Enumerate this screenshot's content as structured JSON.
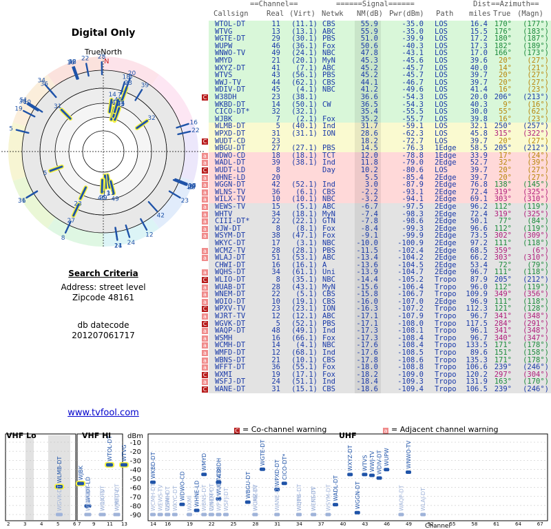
{
  "title": "Digital Only",
  "compass_label": "TrueNorth",
  "north_mark": "N",
  "search": {
    "heading": "Search Criteria",
    "address": "Address: street level",
    "zipcode": "Zipcode 48161",
    "db_label": "db datecode",
    "db_value": "201207061717"
  },
  "link": "www.tvfool.com",
  "headers": {
    "group_channel": "==Channel==",
    "group_signal": "======Signal======",
    "group_dist": "Dist",
    "group_azimuth": "==Azimuth==",
    "callsign": "Callsign",
    "real": "Real",
    "virt": "(Virt)",
    "network": "Netwk",
    "nm": "NM(dB)",
    "pwr": "Pwr(dBm)",
    "path": "Path",
    "miles": "miles",
    "true": "True",
    "magn": "(Magn)"
  },
  "colors": {
    "green": "#d9f7d9",
    "yellow": "#fafad0",
    "red": "#ffd9d9",
    "gray": "#e3e3e3",
    "header_line": "#888888",
    "link": "#0000cc",
    "warn_co": "#b81c1c",
    "warn_adj": "#f08a8a",
    "station_blue": "#1f53a8"
  },
  "stations": [
    {
      "call": "WTOL-DT",
      "real": "11",
      "virt": "(11.1)",
      "net": "CBS",
      "nm": "55.9",
      "pwr": "-35.0",
      "path": "LOS",
      "dist": "16.4",
      "az": "170°",
      "mag": "(177°)",
      "band": "green",
      "warn": ""
    },
    {
      "call": "WTVG",
      "real": "13",
      "virt": "(13.1)",
      "net": "ABC",
      "nm": "55.9",
      "pwr": "-35.0",
      "path": "LOS",
      "dist": "15.5",
      "az": "176°",
      "mag": "(183°)",
      "band": "green",
      "warn": ""
    },
    {
      "call": "WGTE-DT",
      "real": "29",
      "virt": "(30.1)",
      "net": "PBS",
      "nm": "51.0",
      "pwr": "-39.9",
      "path": "LOS",
      "dist": "17.2",
      "az": "180°",
      "mag": "(187°)",
      "band": "green",
      "warn": ""
    },
    {
      "call": "WUPW",
      "real": "46",
      "virt": "(36.1)",
      "net": "Fox",
      "nm": "50.6",
      "pwr": "-40.3",
      "path": "LOS",
      "dist": "17.3",
      "az": "182°",
      "mag": "(189°)",
      "band": "green",
      "warn": ""
    },
    {
      "call": "WNWO-TV",
      "real": "49",
      "virt": "(24.1)",
      "net": "NBC",
      "nm": "47.8",
      "pwr": "-43.1",
      "path": "LOS",
      "dist": "17.0",
      "az": "166°",
      "mag": "(173°)",
      "band": "green",
      "warn": ""
    },
    {
      "call": "WMYD",
      "real": "21",
      "virt": "(20.1)",
      "net": "MyN",
      "nm": "45.3",
      "pwr": "-45.6",
      "path": "LOS",
      "dist": "39.6",
      "az": "20°",
      "mag": "(27°)",
      "band": "green",
      "warn": ""
    },
    {
      "call": "WXYZ-DT",
      "real": "41",
      "virt": "(7.1)",
      "net": "ABC",
      "nm": "45.2",
      "pwr": "-45.7",
      "path": "LOS",
      "dist": "40.0",
      "az": "14°",
      "mag": "(21°)",
      "band": "green",
      "warn": ""
    },
    {
      "call": "WTVS",
      "real": "43",
      "virt": "(56.1)",
      "net": "PBS",
      "nm": "45.2",
      "pwr": "-45.7",
      "path": "LOS",
      "dist": "39.7",
      "az": "20°",
      "mag": "(27°)",
      "band": "green",
      "warn": ""
    },
    {
      "call": "WWJ-TV",
      "real": "44",
      "virt": "(62.1)",
      "net": "CBS",
      "nm": "44.1",
      "pwr": "-46.7",
      "path": "LOS",
      "dist": "39.7",
      "az": "20°",
      "mag": "(27°)",
      "band": "green",
      "warn": ""
    },
    {
      "call": "WDIV-DT",
      "real": "45",
      "virt": "(4.1)",
      "net": "NBC",
      "nm": "41.2",
      "pwr": "-49.6",
      "path": "LOS",
      "dist": "41.4",
      "az": "16°",
      "mag": "(23°)",
      "band": "green",
      "warn": ""
    },
    {
      "call": "W38DH",
      "real": "23",
      "virt": "(38.1)",
      "net": "",
      "nm": "36.6",
      "pwr": "-54.3",
      "path": "LOS",
      "dist": "20.0",
      "az": "206°",
      "mag": "(213°)",
      "band": "green",
      "warn": "C"
    },
    {
      "call": "WKBD-DT",
      "real": "14",
      "virt": "(50.1)",
      "net": "CW",
      "nm": "36.5",
      "pwr": "-54.3",
      "path": "LOS",
      "dist": "40.3",
      "az": "9°",
      "mag": "(16°)",
      "band": "green",
      "warn": ""
    },
    {
      "call": "CICO-DT*",
      "real": "32",
      "virt": "(32.1)",
      "net": "",
      "nm": "35.4",
      "pwr": "-55.5",
      "path": "LOS",
      "dist": "30.0",
      "az": "55°",
      "mag": "(62°)",
      "band": "green",
      "warn": ""
    },
    {
      "call": "WJBK",
      "real": "7",
      "virt": "(2.1)",
      "net": "Fox",
      "nm": "35.2",
      "pwr": "-55.7",
      "path": "LOS",
      "dist": "39.8",
      "az": "16°",
      "mag": "(23°)",
      "band": "green",
      "warn": ""
    },
    {
      "call": "WLMB-DT",
      "real": "5",
      "virt": "(40.1)",
      "net": "Ind",
      "nm": "31.7",
      "pwr": "-59.1",
      "path": "LOS",
      "dist": "32.1",
      "az": "250°",
      "mag": "(257°)",
      "band": "yellow",
      "warn": ""
    },
    {
      "call": "WPXD-DT",
      "real": "31",
      "virt": "(31.1)",
      "net": "ION",
      "nm": "28.6",
      "pwr": "-62.3",
      "path": "LOS",
      "dist": "45.8",
      "az": "315°",
      "mag": "(322°)",
      "band": "yellow",
      "warn": ""
    },
    {
      "call": "WUDT-CD",
      "real": "23",
      "virt": "",
      "net": "",
      "nm": "18.2",
      "pwr": "-72.7",
      "path": "LOS",
      "dist": "39.7",
      "az": "20°",
      "mag": "(27°)",
      "band": "yellow",
      "warn": "C"
    },
    {
      "call": "WBGU-DT",
      "real": "27",
      "virt": "(27.1)",
      "net": "PBS",
      "nm": "14.5",
      "pwr": "-76.3",
      "path": "1Edge",
      "dist": "58.5",
      "az": "205°",
      "mag": "(212°)",
      "band": "yellow",
      "warn": ""
    },
    {
      "call": "WDWO-CD",
      "real": "18",
      "virt": "(18.1)",
      "net": "TCT",
      "nm": "12.0",
      "pwr": "-78.8",
      "path": "1Edge",
      "dist": "33.9",
      "az": "17°",
      "mag": "(24°)",
      "band": "red",
      "warn": "A"
    },
    {
      "call": "WADL-DT",
      "real": "39",
      "virt": "(38.1)",
      "net": "Ind",
      "nm": "11.8",
      "pwr": "-79.0",
      "path": "2Edge",
      "dist": "52.7",
      "az": "32°",
      "mag": "(39°)",
      "band": "red",
      "warn": "A"
    },
    {
      "call": "WUDT-LD",
      "real": "8",
      "virt": "",
      "net": "Day",
      "nm": "10.2",
      "pwr": "-80.6",
      "path": "LOS",
      "dist": "39.7",
      "az": "20°",
      "mag": "(27°)",
      "band": "red",
      "warn": "AC"
    },
    {
      "call": "WHNE-LD",
      "real": "20",
      "virt": "",
      "net": "",
      "nm": "5.5",
      "pwr": "-85.4",
      "path": "2Edge",
      "dist": "39.7",
      "az": "20°",
      "mag": "(27°)",
      "band": "red",
      "warn": "A"
    },
    {
      "call": "WGGN-DT",
      "real": "42",
      "virt": "(52.1)",
      "net": "Ind",
      "nm": "3.0",
      "pwr": "-87.9",
      "path": "2Edge",
      "dist": "76.8",
      "az": "138°",
      "mag": "(145°)",
      "band": "red",
      "warn": "A"
    },
    {
      "call": "WLNS-TV",
      "real": "36",
      "virt": "(6.1)",
      "net": "CBS",
      "nm": "-2.2",
      "pwr": "-93.1",
      "path": "2Edge",
      "dist": "72.4",
      "az": "319°",
      "mag": "(325°)",
      "band": "red",
      "warn": "A"
    },
    {
      "call": "WILX-TV",
      "real": "10",
      "virt": "(10.1)",
      "net": "NBC",
      "nm": "-3.2",
      "pwr": "-94.1",
      "path": "2Edge",
      "dist": "69.1",
      "az": "303°",
      "mag": "(310°)",
      "band": "red",
      "warn": "A"
    },
    {
      "call": "WEWS-TV",
      "real": "15",
      "virt": "(5.1)",
      "net": "ABC",
      "nm": "-6.7",
      "pwr": "-97.5",
      "path": "2Edge",
      "dist": "96.2",
      "az": "112°",
      "mag": "(119°)",
      "band": "gray",
      "warn": "A"
    },
    {
      "call": "WHTV",
      "real": "34",
      "virt": "(18.1)",
      "net": "MyN",
      "nm": "-7.4",
      "pwr": "-98.3",
      "path": "2Edge",
      "dist": "72.4",
      "az": "319°",
      "mag": "(325°)",
      "band": "gray",
      "warn": "A"
    },
    {
      "call": "CIII-DT*",
      "real": "22",
      "virt": "(22.1)",
      "net": "GTN",
      "nm": "-7.8",
      "pwr": "-98.6",
      "path": "2Edge",
      "dist": "50.1",
      "az": "77°",
      "mag": "(84°)",
      "band": "gray",
      "warn": "A"
    },
    {
      "call": "WJW-DT",
      "real": "8",
      "virt": "(8.1)",
      "net": "Fox",
      "nm": "-8.4",
      "pwr": "-99.3",
      "path": "2Edge",
      "dist": "96.6",
      "az": "112°",
      "mag": "(119°)",
      "band": "gray",
      "warn": "A"
    },
    {
      "call": "WSYM-DT",
      "real": "38",
      "virt": "(47.1)",
      "net": "Fox",
      "nm": "-9.1",
      "pwr": "-99.9",
      "path": "2Edge",
      "dist": "73.5",
      "az": "302°",
      "mag": "(309°)",
      "band": "gray",
      "warn": "A"
    },
    {
      "call": "WKYC-DT",
      "real": "17",
      "virt": "(3.1)",
      "net": "NBC",
      "nm": "-10.0",
      "pwr": "-100.9",
      "path": "2Edge",
      "dist": "97.2",
      "az": "111°",
      "mag": "(118°)",
      "band": "gray",
      "warn": ""
    },
    {
      "call": "WCMZ-TV",
      "real": "28",
      "virt": "(28.1)",
      "net": "PBS",
      "nm": "-11.5",
      "pwr": "-102.4",
      "path": "2Edge",
      "dist": "68.5",
      "az": "359°",
      "mag": "(6°)",
      "band": "gray",
      "warn": "A"
    },
    {
      "call": "WLAJ-DT",
      "real": "51",
      "virt": "(53.1)",
      "net": "ABC",
      "nm": "-13.4",
      "pwr": "-104.2",
      "path": "2Edge",
      "dist": "66.2",
      "az": "303°",
      "mag": "(310°)",
      "band": "gray",
      "warn": "A"
    },
    {
      "call": "CHWI-DT",
      "real": "16",
      "virt": "(16.1)",
      "net": "A",
      "nm": "-13.6",
      "pwr": "-104.5",
      "path": "2Edge",
      "dist": "53.4",
      "az": "72°",
      "mag": "(79°)",
      "band": "gray",
      "warn": ""
    },
    {
      "call": "WQHS-DT",
      "real": "34",
      "virt": "(61.1)",
      "net": "Uni",
      "nm": "-13.9",
      "pwr": "-104.7",
      "path": "2Edge",
      "dist": "96.7",
      "az": "111°",
      "mag": "(118°)",
      "band": "gray",
      "warn": "A"
    },
    {
      "call": "WLIO-DT",
      "real": "8",
      "virt": "(35.1)",
      "net": "NBC",
      "nm": "-14.4",
      "pwr": "-105.2",
      "path": "Tropo",
      "dist": "87.9",
      "az": "205°",
      "mag": "(212°)",
      "band": "gray",
      "warn": "AC"
    },
    {
      "call": "WUAB-DT",
      "real": "28",
      "virt": "(43.1)",
      "net": "MyN",
      "nm": "-15.6",
      "pwr": "-106.4",
      "path": "Tropo",
      "dist": "96.0",
      "az": "112°",
      "mag": "(119°)",
      "band": "gray",
      "warn": "A"
    },
    {
      "call": "WNEM-DT",
      "real": "22",
      "virt": "(5.1)",
      "net": "CBS",
      "nm": "-15.8",
      "pwr": "-106.7",
      "path": "Tropo",
      "dist": "109.9",
      "az": "349°",
      "mag": "(356°)",
      "band": "gray",
      "warn": "A"
    },
    {
      "call": "WOIO-DT",
      "real": "10",
      "virt": "(19.1)",
      "net": "CBS",
      "nm": "-16.0",
      "pwr": "-107.0",
      "path": "2Edge",
      "dist": "96.9",
      "az": "111°",
      "mag": "(118°)",
      "band": "gray",
      "warn": "A"
    },
    {
      "call": "WPXV-TV",
      "real": "23",
      "virt": "(23.1)",
      "net": "ION",
      "nm": "-16.3",
      "pwr": "-107.2",
      "path": "Tropo",
      "dist": "112.3",
      "az": "121°",
      "mag": "(128°)",
      "band": "gray",
      "warn": "C"
    },
    {
      "call": "WJRT-TV",
      "real": "12",
      "virt": "(12.1)",
      "net": "ABC",
      "nm": "-17.1",
      "pwr": "-107.9",
      "path": "Tropo",
      "dist": "96.7",
      "az": "341°",
      "mag": "(348°)",
      "band": "gray",
      "warn": "A"
    },
    {
      "call": "WGVK-DT",
      "real": "5",
      "virt": "(52.1)",
      "net": "PBS",
      "nm": "-17.1",
      "pwr": "-108.0",
      "path": "Tropo",
      "dist": "117.5",
      "az": "284°",
      "mag": "(291°)",
      "band": "gray",
      "warn": "C"
    },
    {
      "call": "WAQP-DT",
      "real": "48",
      "virt": "(49.1)",
      "net": "Ind",
      "nm": "-17.3",
      "pwr": "-108.1",
      "path": "Tropo",
      "dist": "96.1",
      "az": "341°",
      "mag": "(348°)",
      "band": "gray",
      "warn": "A"
    },
    {
      "call": "WSMH",
      "real": "16",
      "virt": "(66.1)",
      "net": "Fox",
      "nm": "-17.3",
      "pwr": "-108.4",
      "path": "Tropo",
      "dist": "96.7",
      "az": "340°",
      "mag": "(347°)",
      "band": "gray",
      "warn": "A"
    },
    {
      "call": "WCMH-DT",
      "real": "14",
      "virt": "(4.1)",
      "net": "NBC",
      "nm": "-17.6",
      "pwr": "-108.4",
      "path": "Tropo",
      "dist": "133.5",
      "az": "171°",
      "mag": "(178°)",
      "band": "gray",
      "warn": "A"
    },
    {
      "call": "WMFD-DT",
      "real": "12",
      "virt": "(68.1)",
      "net": "Ind",
      "nm": "-17.6",
      "pwr": "-108.5",
      "path": "Tropo",
      "dist": "89.6",
      "az": "151°",
      "mag": "(158°)",
      "band": "gray",
      "warn": "A"
    },
    {
      "call": "WBNS-DT",
      "real": "21",
      "virt": "(10.1)",
      "net": "CBS",
      "nm": "-17.8",
      "pwr": "-108.6",
      "path": "Tropo",
      "dist": "135.3",
      "az": "171°",
      "mag": "(178°)",
      "band": "gray",
      "warn": "A"
    },
    {
      "call": "WFFT-DT",
      "real": "36",
      "virt": "(55.1)",
      "net": "Fox",
      "nm": "-18.0",
      "pwr": "-108.8",
      "path": "Tropo",
      "dist": "106.6",
      "az": "239°",
      "mag": "(246°)",
      "band": "gray",
      "warn": "A"
    },
    {
      "call": "WXMI",
      "real": "19",
      "virt": "(17.1)",
      "net": "Fox",
      "nm": "-18.2",
      "pwr": "-109.0",
      "path": "Tropo",
      "dist": "120.2",
      "az": "297°",
      "mag": "(304°)",
      "band": "gray",
      "warn": "C"
    },
    {
      "call": "WSFJ-DT",
      "real": "24",
      "virt": "(51.1)",
      "net": "Ind",
      "nm": "-18.4",
      "pwr": "-109.3",
      "path": "Tropo",
      "dist": "131.9",
      "az": "163°",
      "mag": "(170°)",
      "band": "gray",
      "warn": "A"
    },
    {
      "call": "WANE-DT",
      "real": "31",
      "virt": "(15.1)",
      "net": "CBS",
      "nm": "-18.6",
      "pwr": "-109.4",
      "path": "Tropo",
      "dist": "106.5",
      "az": "239°",
      "mag": "(246°)",
      "band": "gray",
      "warn": "C"
    }
  ],
  "legend": {
    "co_channel": "= Co-channel warning",
    "adjacent": "= Adjacent channel warning",
    "co_icon": "C",
    "adj_icon": "a"
  },
  "spectrum": {
    "vhf_lo": "VHF Lo",
    "vhf_hi": "VHF Hi",
    "uhf": "UHF",
    "unit": "dBm",
    "x_label": "Channel",
    "db_ticks": [
      "-10",
      "-20",
      "-30",
      "-40",
      "-50",
      "-60",
      "-70",
      "-80",
      "-90"
    ],
    "vhf_lo_channels": [
      "2",
      "3",
      "4",
      "5",
      "6"
    ],
    "vhf_hi_channels": [
      "7",
      "9",
      "11",
      "13"
    ],
    "uhf_channels": [
      "14",
      "16",
      "19",
      "22",
      "25",
      "28",
      "31",
      "34",
      "37",
      "40",
      "43",
      "46",
      "49",
      "52",
      "55",
      "58",
      "61",
      "64",
      "67",
      "69"
    ]
  }
}
